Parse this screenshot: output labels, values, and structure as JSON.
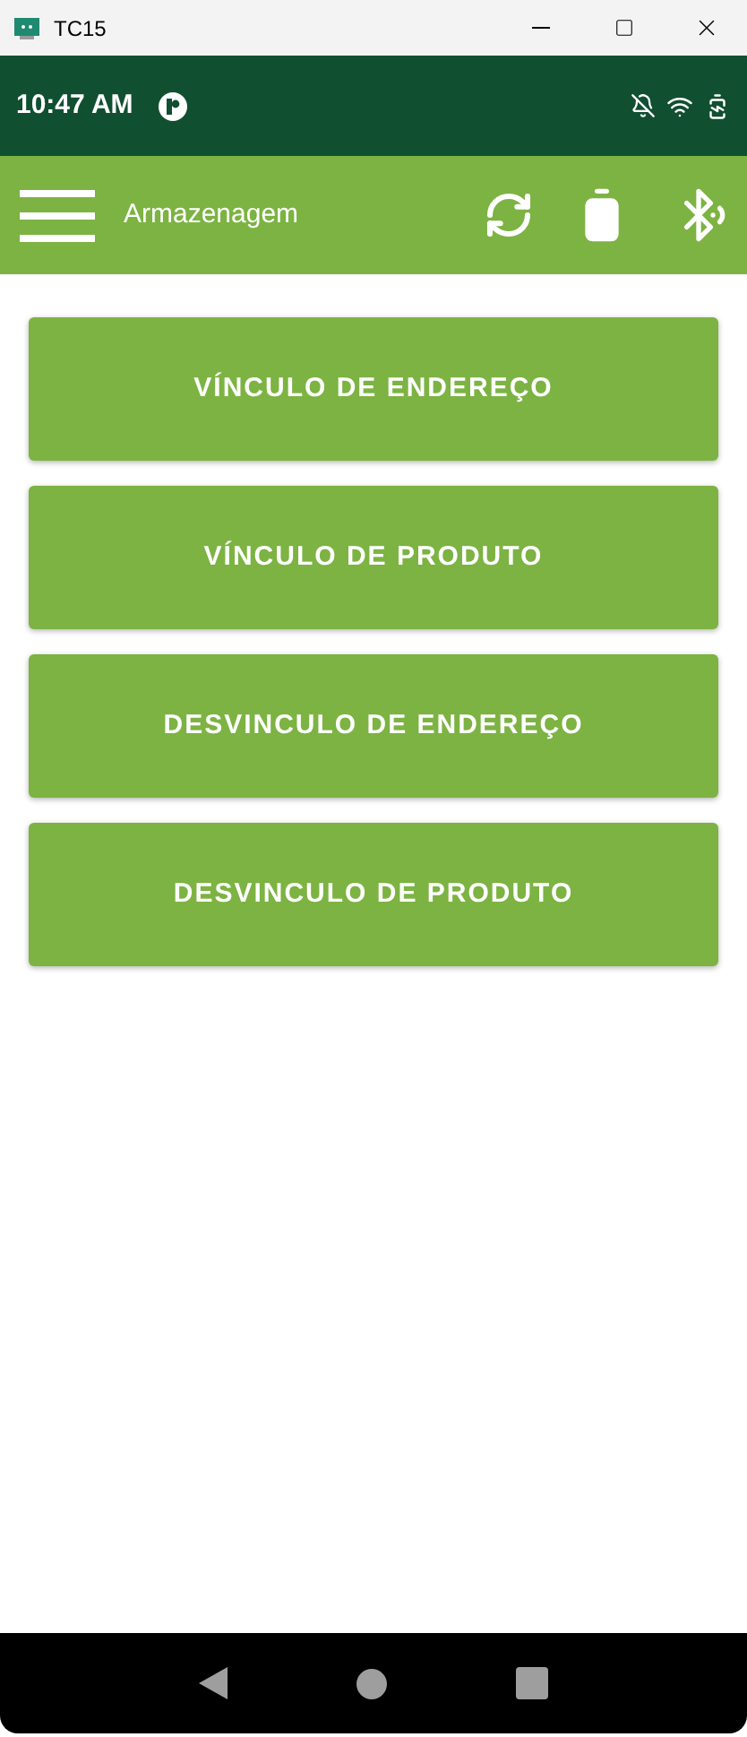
{
  "window": {
    "title": "TC15"
  },
  "status_bar": {
    "time": "10:47 AM"
  },
  "app_bar": {
    "title": "Armazenagem"
  },
  "buttons": [
    {
      "label": "VÍNCULO DE ENDEREÇO"
    },
    {
      "label": "VÍNCULO DE PRODUTO"
    },
    {
      "label": "DESVINCULO DE ENDEREÇO"
    },
    {
      "label": "DESVINCULO DE PRODUTO"
    }
  ]
}
